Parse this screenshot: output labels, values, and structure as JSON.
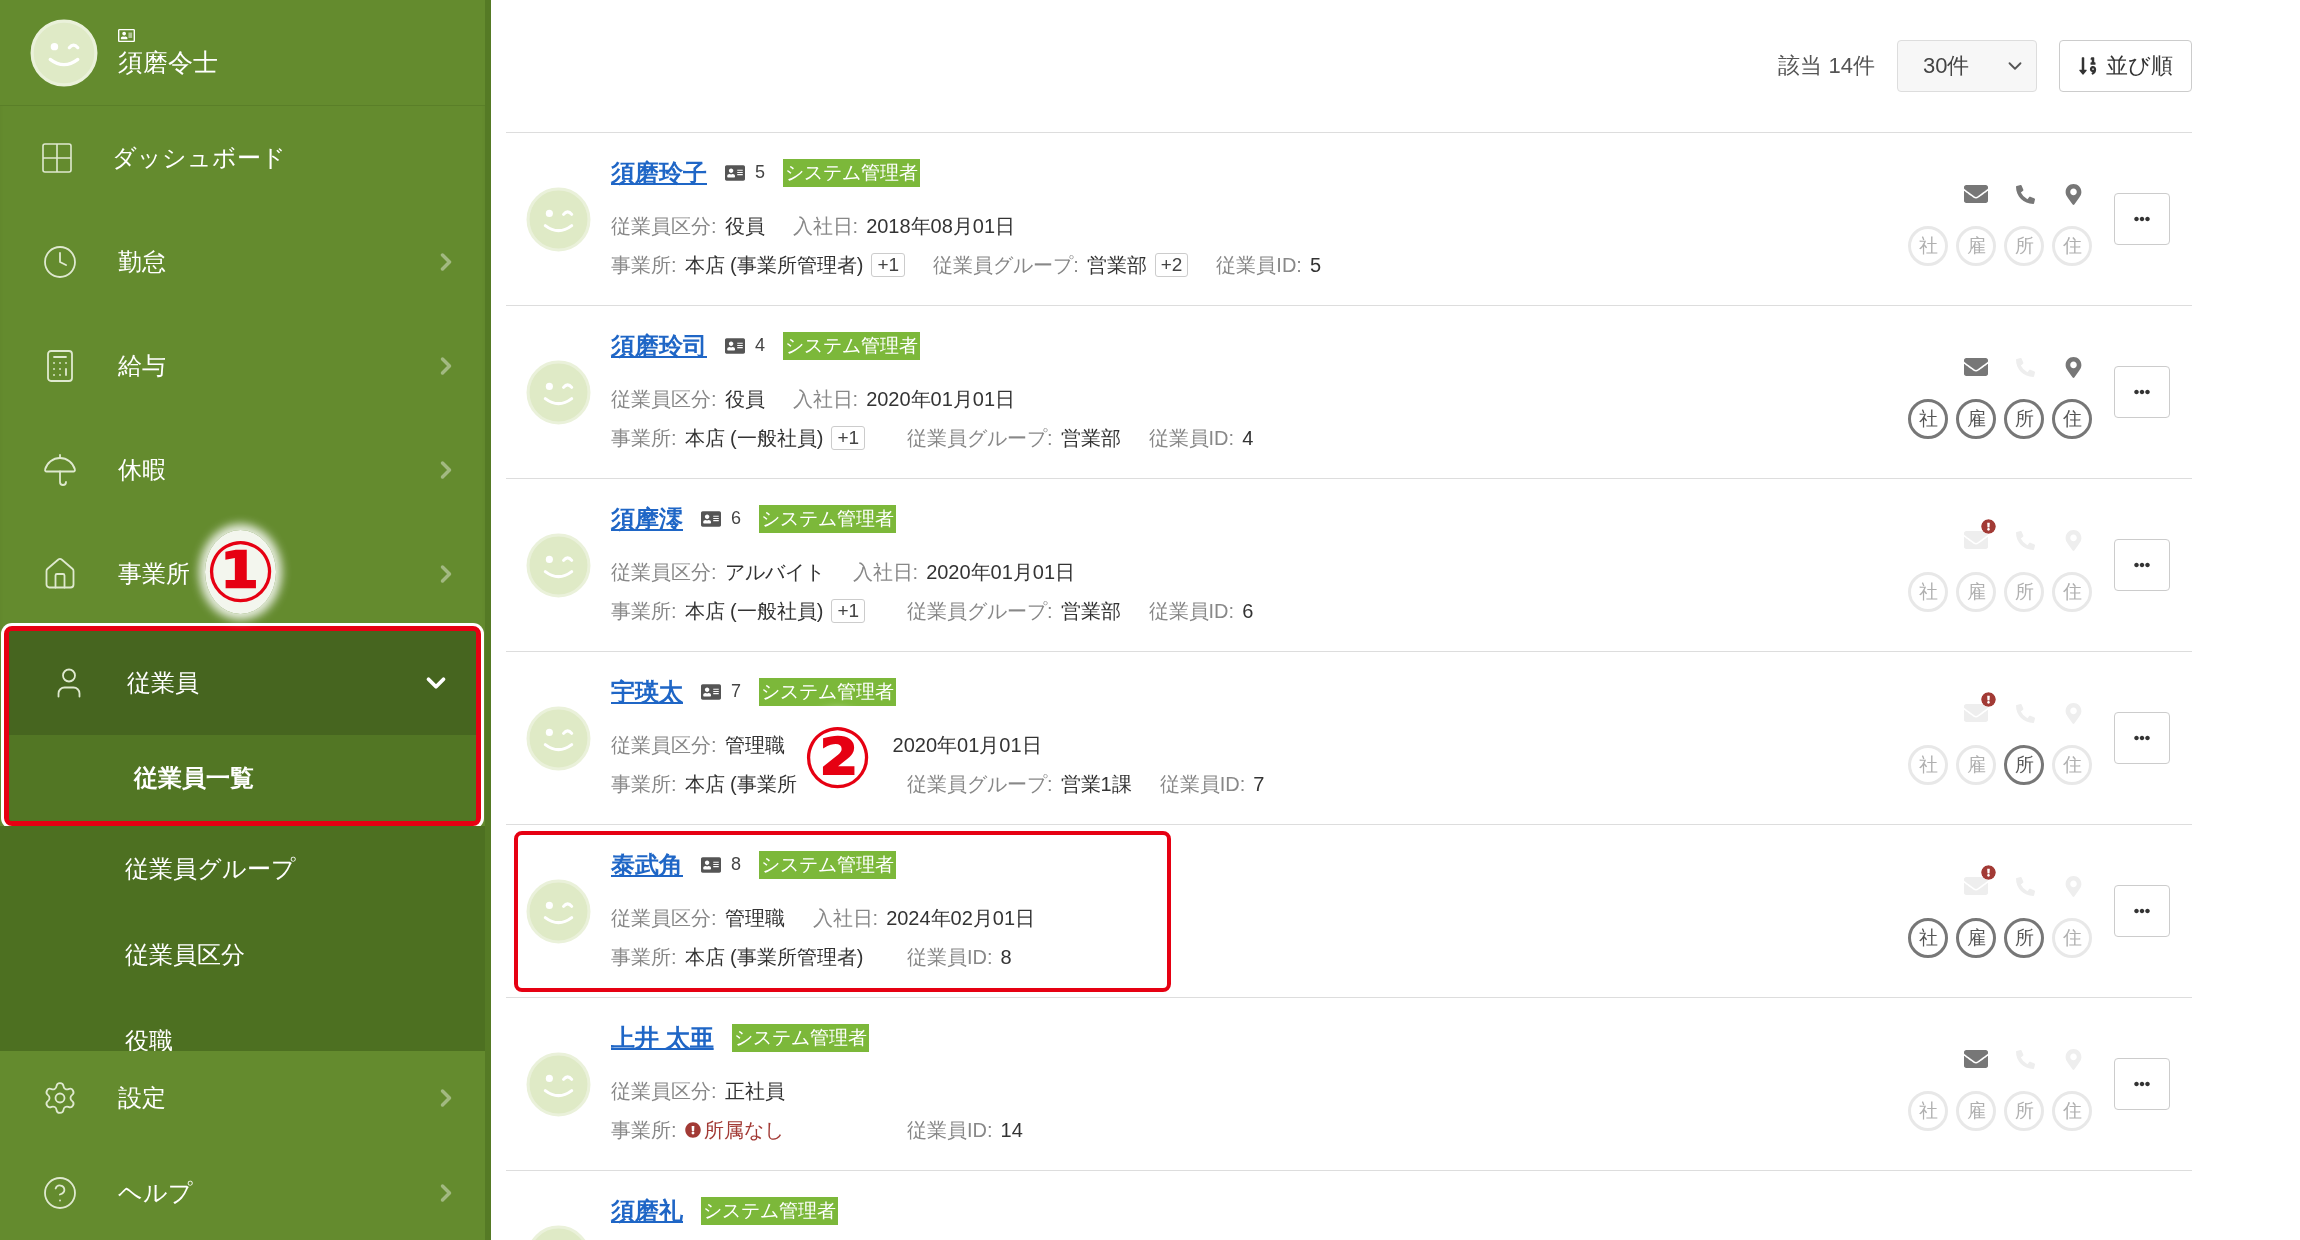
{
  "user": {
    "name": "須磨令士"
  },
  "nav": {
    "items": [
      {
        "label": "ダッシュボード",
        "kind": "dash"
      },
      {
        "label": "勤怠",
        "kind": "clock",
        "expanded": false
      },
      {
        "label": "給与",
        "kind": "calculator",
        "expanded": false
      },
      {
        "label": "休暇",
        "kind": "umbrella",
        "expanded": false
      },
      {
        "label": "事業所",
        "kind": "home",
        "expanded": false,
        "marker": "①"
      },
      {
        "label": "従業員",
        "kind": "person",
        "expanded": true,
        "highlighted": true,
        "children": [
          {
            "label": "従業員一覧",
            "selected": true,
            "highlighted": true
          },
          {
            "label": "従業員グループ",
            "selected": false,
            "highlighted": false
          },
          {
            "label": "従業員区分",
            "selected": false,
            "highlighted": false
          },
          {
            "label": "役職",
            "selected": false,
            "highlighted": false
          }
        ]
      }
    ],
    "footer_items": [
      {
        "label": "設定",
        "kind": "gear",
        "expanded": false
      },
      {
        "label": "ヘルプ",
        "kind": "help",
        "expanded": false
      }
    ]
  },
  "toolbar": {
    "count": "該当 14件",
    "per_page": "30件",
    "sort_button": "並び順"
  },
  "rows": [
    {
      "name": "須磨玲子",
      "card_number": "5",
      "tag": "システム管理者",
      "highlighted": false,
      "lines": [
        [
          {
            "label": "従業員区分:",
            "value": "役員",
            "kind": "plain"
          },
          {
            "label": "入社日:",
            "value": "2018年08月01日",
            "kind": "plain"
          }
        ],
        [
          {
            "label": "事業所:",
            "value": "本店 (事業所管理者)",
            "badge": "+1",
            "kind": "plain"
          },
          {
            "label": "従業員グループ:",
            "value": "営業部",
            "badge": "+2",
            "kind": "plain"
          },
          {
            "label": "従業員ID:",
            "value": "5",
            "kind": "plain"
          }
        ]
      ],
      "contacts": [
        {
          "kind": "mail",
          "active": true,
          "alert": false
        },
        {
          "kind": "phone",
          "active": true,
          "alert": false
        },
        {
          "kind": "pin",
          "active": true,
          "alert": false
        }
      ],
      "documents": [
        {
          "label": "社",
          "active": false
        },
        {
          "label": "雇",
          "active": false
        },
        {
          "label": "所",
          "active": false
        },
        {
          "label": "住",
          "active": false
        }
      ]
    },
    {
      "name": "須磨玲司",
      "card_number": "4",
      "tag": "システム管理者",
      "highlighted": false,
      "lines": [
        [
          {
            "label": "従業員区分:",
            "value": "役員",
            "kind": "plain"
          },
          {
            "label": "入社日:",
            "value": "2020年01月01日",
            "kind": "plain"
          }
        ],
        [
          {
            "label": "事業所:",
            "value": "本店 (一般社員)",
            "badge": "+1",
            "kind": "plain"
          },
          {
            "label": "従業員グループ:",
            "value": "営業部",
            "kind": "plain"
          },
          {
            "label": "従業員ID:",
            "value": "4",
            "kind": "plain"
          }
        ]
      ],
      "contacts": [
        {
          "kind": "mail",
          "active": true,
          "alert": false
        },
        {
          "kind": "phone",
          "active": false,
          "alert": false
        },
        {
          "kind": "pin",
          "active": true,
          "alert": false
        }
      ],
      "documents": [
        {
          "label": "社",
          "active": true
        },
        {
          "label": "雇",
          "active": true
        },
        {
          "label": "所",
          "active": true
        },
        {
          "label": "住",
          "active": true
        }
      ]
    },
    {
      "name": "須摩澪",
      "card_number": "6",
      "tag": "システム管理者",
      "highlighted": false,
      "lines": [
        [
          {
            "label": "従業員区分:",
            "value": "アルバイト",
            "kind": "plain"
          },
          {
            "label": "入社日:",
            "value": "2020年01月01日",
            "kind": "plain"
          }
        ],
        [
          {
            "label": "事業所:",
            "value": "本店 (一般社員)",
            "badge": "+1",
            "kind": "plain"
          },
          {
            "label": "従業員グループ:",
            "value": "営業部",
            "kind": "plain"
          },
          {
            "label": "従業員ID:",
            "value": "6",
            "kind": "plain"
          }
        ]
      ],
      "contacts": [
        {
          "kind": "mail",
          "active": false,
          "alert": true
        },
        {
          "kind": "phone",
          "active": false,
          "alert": false
        },
        {
          "kind": "pin",
          "active": false,
          "alert": false
        }
      ],
      "documents": [
        {
          "label": "社",
          "active": false
        },
        {
          "label": "雇",
          "active": false
        },
        {
          "label": "所",
          "active": false
        },
        {
          "label": "住",
          "active": false
        }
      ]
    },
    {
      "name": "宇瑛太",
      "card_number": "7",
      "tag": "システム管理者",
      "highlighted": false,
      "marker": "②",
      "lines": [
        [
          {
            "label": "従業員区分:",
            "value": "管理職",
            "kind": "plain"
          },
          {
            "value": "2020年01月01日",
            "kind": "plain"
          }
        ],
        [
          {
            "label": "事業所:",
            "value": "本店 (事業所",
            "kind": "plain"
          },
          {
            "label": "従業員グループ:",
            "value": "営業1課",
            "kind": "plain"
          },
          {
            "label": "従業員ID:",
            "value": "7",
            "kind": "plain"
          }
        ]
      ],
      "contacts": [
        {
          "kind": "mail",
          "active": false,
          "alert": true
        },
        {
          "kind": "phone",
          "active": false,
          "alert": false
        },
        {
          "kind": "pin",
          "active": false,
          "alert": false
        }
      ],
      "documents": [
        {
          "label": "社",
          "active": false
        },
        {
          "label": "雇",
          "active": false
        },
        {
          "label": "所",
          "active": true
        },
        {
          "label": "住",
          "active": false
        }
      ]
    },
    {
      "name": "泰武角",
      "card_number": "8",
      "tag": "システム管理者",
      "highlighted": true,
      "lines": [
        [
          {
            "label": "従業員区分:",
            "value": "管理職",
            "kind": "plain"
          },
          {
            "label": "入社日:",
            "value": "2024年02月01日",
            "kind": "plain"
          }
        ],
        [
          {
            "label": "事業所:",
            "value": "本店 (事業所管理者)",
            "kind": "plain"
          },
          {
            "label": "従業員ID:",
            "value": "8",
            "kind": "plain"
          }
        ]
      ],
      "contacts": [
        {
          "kind": "mail",
          "active": false,
          "alert": true
        },
        {
          "kind": "phone",
          "active": false,
          "alert": false
        },
        {
          "kind": "pin",
          "active": false,
          "alert": false
        }
      ],
      "documents": [
        {
          "label": "社",
          "active": true
        },
        {
          "label": "雇",
          "active": true
        },
        {
          "label": "所",
          "active": true
        },
        {
          "label": "住",
          "active": false
        }
      ]
    },
    {
      "name": "上井 太亜",
      "tag": "システム管理者",
      "highlighted": false,
      "lines": [
        [
          {
            "label": "従業員区分:",
            "value": "正社員",
            "kind": "plain"
          }
        ],
        [
          {
            "label": "事業所:",
            "value": "所属なし",
            "kind": "warning"
          },
          {
            "label": "従業員ID:",
            "value": "14",
            "kind": "plain"
          }
        ]
      ],
      "contacts": [
        {
          "kind": "mail",
          "active": true,
          "alert": false
        },
        {
          "kind": "phone",
          "active": false,
          "alert": false
        },
        {
          "kind": "pin",
          "active": false,
          "alert": false
        }
      ],
      "documents": [
        {
          "label": "社",
          "active": false
        },
        {
          "label": "雇",
          "active": false
        },
        {
          "label": "所",
          "active": false
        },
        {
          "label": "住",
          "active": false
        }
      ]
    },
    {
      "name": "須磨礼",
      "tag": "システム管理者",
      "highlighted": false
    }
  ]
}
